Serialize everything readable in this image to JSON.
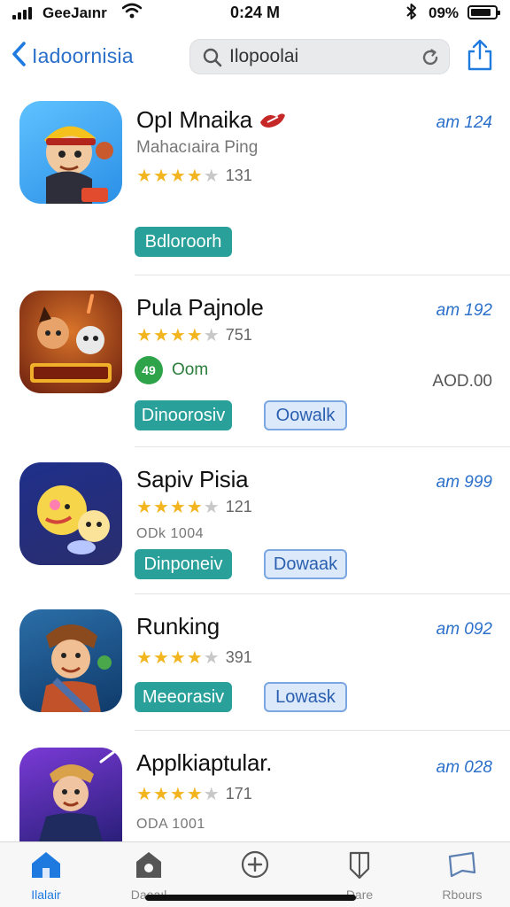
{
  "status_bar": {
    "carrier": "GeeJaınr",
    "time": "0:24 M",
    "battery": "09%"
  },
  "nav": {
    "back_label": "Iadoornisia",
    "search_value": "Ilopoolai"
  },
  "apps": [
    {
      "name": "OpI Mnaika",
      "subtitle": "Mahacıaira Ping",
      "rating": 4.5,
      "rating_count": "131",
      "meta": "am 124",
      "primary_label": "Bdloroorh"
    },
    {
      "name": "Pula Pajnole",
      "rating": 4.5,
      "rating_count": "751",
      "meta": "am 192",
      "badge_text": "Oom",
      "price": "AOD.00",
      "primary_label": "Dinoorosiv",
      "secondary_label": "Oowalk"
    },
    {
      "name": "Sapiv Pisia",
      "rating": 4.5,
      "rating_count": "121",
      "meta": "am 999",
      "detail": "ODk 1004",
      "primary_label": "Dinponeiv",
      "secondary_label": "Dowaak"
    },
    {
      "name": "Runking",
      "rating": 4.5,
      "rating_count": "391",
      "meta": "am 092",
      "primary_label": "Meeorasiv",
      "secondary_label": "Lowask"
    },
    {
      "name": "Applkiaptular.",
      "rating": 4.5,
      "rating_count": "171",
      "meta": "am 028",
      "detail": "ODA 1001"
    }
  ],
  "tabs": [
    {
      "label": "Ilalair",
      "icon": "home-icon",
      "active": true
    },
    {
      "label": "Daoaıl",
      "icon": "house-badge-icon",
      "active": false
    },
    {
      "label": "",
      "icon": "plus-circle-icon",
      "active": false
    },
    {
      "label": "Dare",
      "icon": "shield-icon",
      "active": false
    },
    {
      "label": "Rbours",
      "icon": "bookmark-icon",
      "active": false
    }
  ],
  "colors": {
    "accent": "#1f7ae0",
    "primary_button": "#2aa09a",
    "secondary_button_bg": "#dce9fb",
    "star": "#f2b51f"
  }
}
